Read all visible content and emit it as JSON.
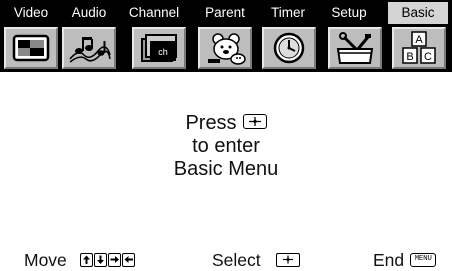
{
  "tabs": [
    {
      "label": "Video",
      "icon": "video-picture-icon"
    },
    {
      "label": "Audio",
      "icon": "audio-music-notes-icon"
    },
    {
      "label": "Channel",
      "icon": "channel-ch-icon"
    },
    {
      "label": "Parent",
      "icon": "parent-bear-icon"
    },
    {
      "label": "Timer",
      "icon": "timer-clock-icon"
    },
    {
      "label": "Setup",
      "icon": "setup-toolbox-icon"
    },
    {
      "label": "Basic",
      "icon": "basic-abc-blocks-icon",
      "active": true
    }
  ],
  "message": {
    "line1": "Press",
    "line2": "to enter",
    "line3": "Basic Menu"
  },
  "footer": {
    "move_label": "Move",
    "select_label": "Select",
    "end_label": "End",
    "menu_key_label": "MENU"
  },
  "colors": {
    "tab_bar_bg": "#000000",
    "tab_text": "#ffffff",
    "active_tab_bg": "#d4d4d4",
    "icon_tile_bg": "#bdbdbd",
    "page_bg": "#ffffff"
  }
}
